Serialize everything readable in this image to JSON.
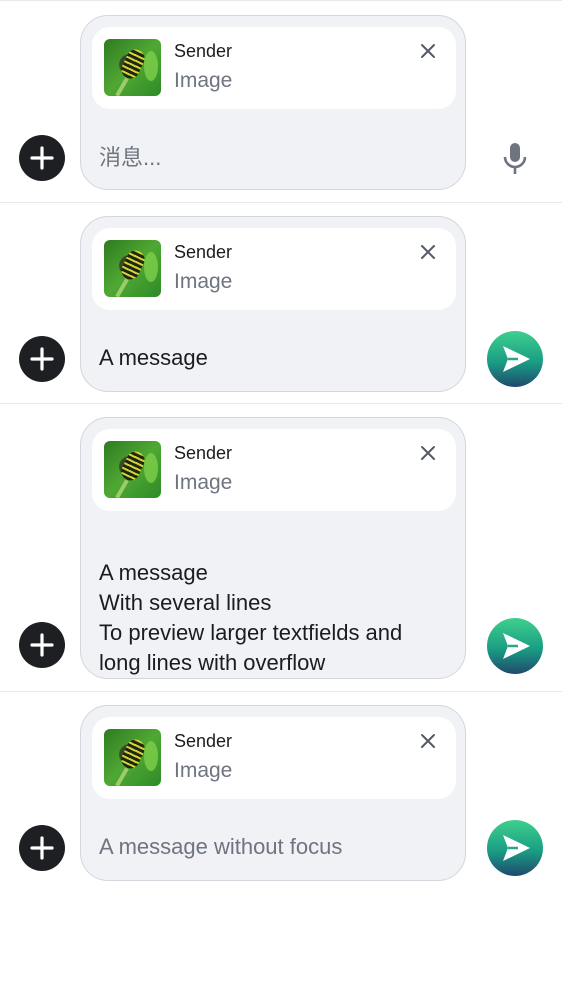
{
  "composers": [
    {
      "sender": "Sender",
      "attachment_label": "Image",
      "message": "消息...",
      "placeholder": true,
      "action": "mic-icon"
    },
    {
      "sender": "Sender",
      "attachment_label": "Image",
      "message": "A message",
      "placeholder": false,
      "action": "send-icon"
    },
    {
      "sender": "Sender",
      "attachment_label": "Image",
      "message": "A message\nWith several lines\nTo preview larger textfields and\nlong lines with overflow",
      "placeholder": false,
      "action": "send-icon"
    },
    {
      "sender": "Sender",
      "attachment_label": "Image",
      "message": "A message without focus",
      "placeholder": true,
      "action": "send-icon"
    }
  ],
  "colors": {
    "send_top": "#3fcf8e",
    "send_bottom": "#1f4a6e",
    "plus_bg": "#1d1f23",
    "composer_bg": "#f0f2f5"
  }
}
